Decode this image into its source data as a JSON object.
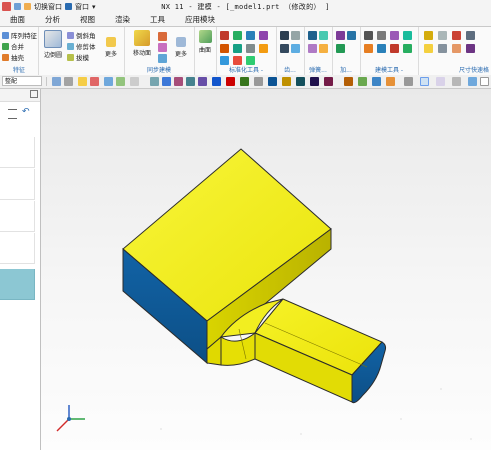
{
  "titlebar": {
    "title": "NX 11 - 建模 - [_model1.prt （修改的） ]",
    "switch_window": "切换窗口",
    "window_menu": "窗口"
  },
  "tabs": [
    "曲面",
    "分析",
    "视图",
    "渲染",
    "工具",
    "应用模块"
  ],
  "ribbon": {
    "feature_group": {
      "label": "特征",
      "items": [
        "阵列特征",
        "合并",
        "抽壳"
      ]
    },
    "shell_button": "边倒圆",
    "edge_items": [
      "倒斜角",
      "修剪体",
      "拔模"
    ],
    "more1": "更多",
    "sync": {
      "label": "同步建模",
      "move_face": "移动面",
      "more": "更多"
    },
    "surface": {
      "face": "曲面"
    },
    "std_tools": "标准化工具 -",
    "gear": "齿...",
    "spring": "弹簧...",
    "machining": "加...",
    "build_tools": "建模工具 -",
    "dim_quick": "尺寸快速格"
  },
  "toolbar": {
    "select_label": "整配"
  },
  "colors": {
    "yellow_face": "#f4f00c",
    "blue_face": "#0f5f9e",
    "edge": "#2b2b2b",
    "tab_teal": "#8cc7d3"
  },
  "icons": [
    "pattern-icon",
    "unite-icon",
    "shell-icon",
    "edge-blend-icon",
    "chamfer-icon",
    "trim-body-icon",
    "draft-icon",
    "move-face-icon",
    "surface-icon",
    "triad-icon"
  ]
}
